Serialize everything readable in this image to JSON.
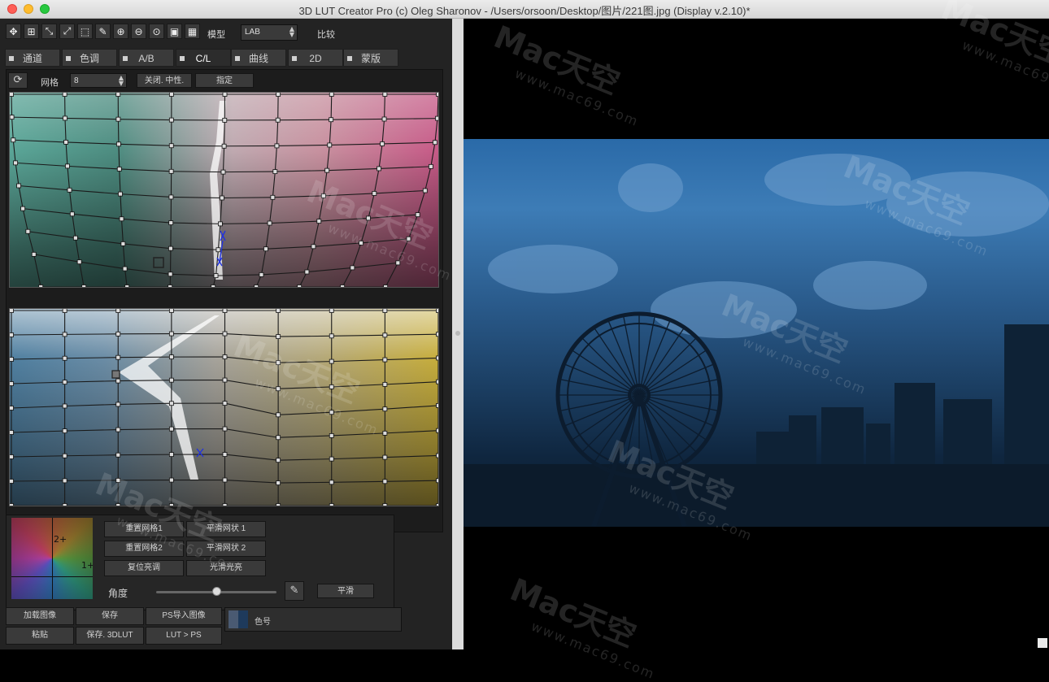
{
  "window": {
    "title": "3D LUT Creator Pro (c) Oleg Sharonov - /Users/orsoon/Desktop/图片/221图.jpg (Display v.2.10)*"
  },
  "toolbar": {
    "icons": [
      "move-icon",
      "grid-icon",
      "shrink-icon",
      "expand-icon",
      "marquee-icon",
      "eyedropper-icon",
      "zoom-in-icon",
      "zoom-out-icon",
      "zoom-fit-icon",
      "frame-icon",
      "grid-view-icon"
    ],
    "glyphs": [
      "✥",
      "⊞",
      "⤡",
      "⤢",
      "⬚",
      "✎",
      "⊕",
      "⊖",
      "⊙",
      "▣",
      "▦"
    ],
    "model_label": "模型",
    "model_value": "LAB",
    "compare_label": "比较"
  },
  "tabs": [
    {
      "label": "通道",
      "checkbox": true
    },
    {
      "label": "色调",
      "checkbox": true
    },
    {
      "label": "A/B",
      "checkbox": true
    },
    {
      "label": "C/L",
      "checkbox": true,
      "active": true
    },
    {
      "label": "曲线",
      "checkbox": true
    },
    {
      "label": "2D",
      "checkbox": true
    },
    {
      "label": "蒙版",
      "checkbox": true
    }
  ],
  "subbar": {
    "refresh_glyph": "⟳",
    "grid_label": "网格",
    "grid_value": "8",
    "neutral_button": "关闭. 中性.",
    "assign_button": "指定"
  },
  "controls": {
    "wheel_label_top": "2+",
    "wheel_label_right": "1+",
    "reset_grid1": "重置网格1",
    "smooth_grid1": "平滑网状 1",
    "reset_grid2": "重置网格2",
    "smooth_grid2": "平滑网状 2",
    "reset_tone": "复位亮调",
    "smooth_light": "光滑光亮",
    "angle_label": "角度",
    "angle_value": 0.5,
    "smooth_button": "平滑"
  },
  "bottom_buttons": {
    "load_image": "加载图像",
    "save": "保存",
    "ps_import": "PS导入图像",
    "paste": "粘贴",
    "save_3dlut": "保存. 3DLUT",
    "lut_to_ps": "LUT > PS",
    "color_label": "色号"
  },
  "watermark": {
    "brand": "Mac天空",
    "url": "www.mac69.com"
  },
  "colors": {
    "panel_bg": "#232323",
    "button_bg": "#3a3a3a",
    "marker_blue": "#2233dd"
  }
}
